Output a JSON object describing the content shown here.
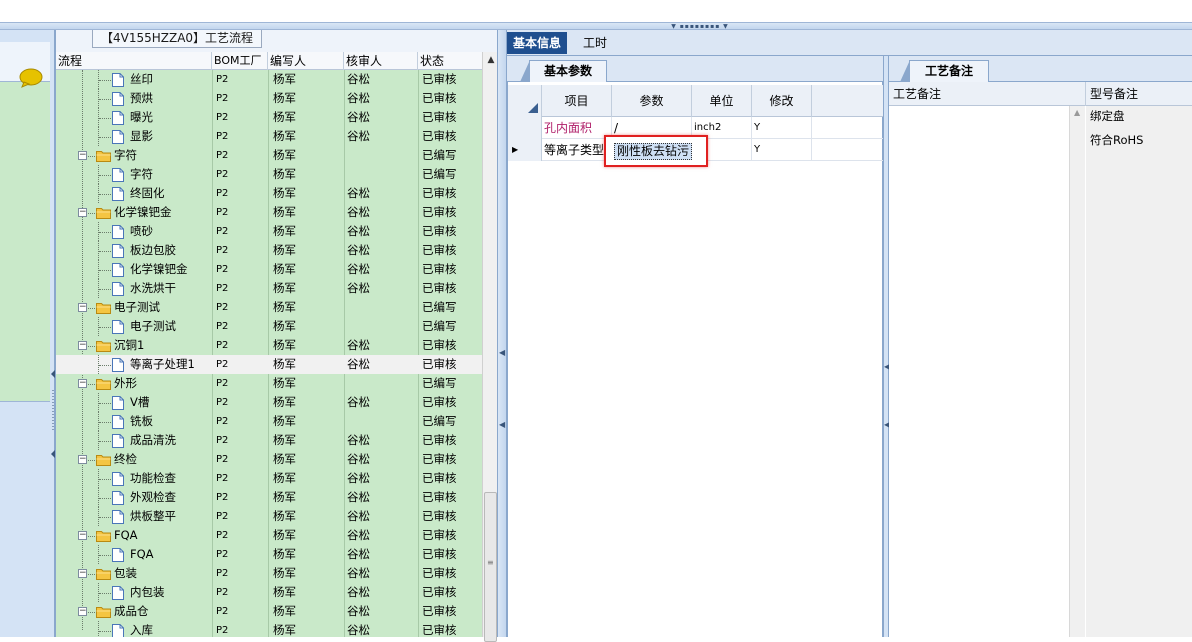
{
  "tree": {
    "title": "【4V155HZZA0】工艺流程",
    "columns": [
      "流程",
      "BOM工厂",
      "编写人",
      "核审人",
      "状态"
    ],
    "rows": [
      {
        "name": "丝印",
        "type": "doc",
        "bom": "P2",
        "author": "杨军",
        "reviewer": "谷松",
        "status": "已审核"
      },
      {
        "name": "预烘",
        "type": "doc",
        "bom": "P2",
        "author": "杨军",
        "reviewer": "谷松",
        "status": "已审核"
      },
      {
        "name": "曝光",
        "type": "doc",
        "bom": "P2",
        "author": "杨军",
        "reviewer": "谷松",
        "status": "已审核"
      },
      {
        "name": "显影",
        "type": "doc",
        "bom": "P2",
        "author": "杨军",
        "reviewer": "谷松",
        "status": "已审核"
      },
      {
        "name": "字符",
        "type": "folder",
        "bom": "P2",
        "author": "杨军",
        "reviewer": "",
        "status": "已编写"
      },
      {
        "name": "字符",
        "type": "doc",
        "bom": "P2",
        "author": "杨军",
        "reviewer": "",
        "status": "已编写"
      },
      {
        "name": "终固化",
        "type": "doc",
        "bom": "P2",
        "author": "杨军",
        "reviewer": "谷松",
        "status": "已审核"
      },
      {
        "name": "化学镍钯金",
        "type": "folder",
        "bom": "P2",
        "author": "杨军",
        "reviewer": "谷松",
        "status": "已审核"
      },
      {
        "name": "喷砂",
        "type": "doc",
        "bom": "P2",
        "author": "杨军",
        "reviewer": "谷松",
        "status": "已审核"
      },
      {
        "name": "板边包胶",
        "type": "doc",
        "bom": "P2",
        "author": "杨军",
        "reviewer": "谷松",
        "status": "已审核"
      },
      {
        "name": "化学镍钯金",
        "type": "doc",
        "bom": "P2",
        "author": "杨军",
        "reviewer": "谷松",
        "status": "已审核"
      },
      {
        "name": "水洗烘干",
        "type": "doc",
        "bom": "P2",
        "author": "杨军",
        "reviewer": "谷松",
        "status": "已审核"
      },
      {
        "name": "电子测试",
        "type": "folder",
        "bom": "P2",
        "author": "杨军",
        "reviewer": "",
        "status": "已编写"
      },
      {
        "name": "电子测试",
        "type": "doc",
        "bom": "P2",
        "author": "杨军",
        "reviewer": "",
        "status": "已编写"
      },
      {
        "name": "沉铜1",
        "type": "folder",
        "bom": "P2",
        "author": "杨军",
        "reviewer": "谷松",
        "status": "已审核"
      },
      {
        "name": "等离子处理1",
        "type": "doc",
        "bom": "P2",
        "author": "杨军",
        "reviewer": "谷松",
        "status": "已审核",
        "selected": true
      },
      {
        "name": "外形",
        "type": "folder",
        "bom": "P2",
        "author": "杨军",
        "reviewer": "",
        "status": "已编写"
      },
      {
        "name": "V槽",
        "type": "doc",
        "bom": "P2",
        "author": "杨军",
        "reviewer": "谷松",
        "status": "已审核"
      },
      {
        "name": "铣板",
        "type": "doc",
        "bom": "P2",
        "author": "杨军",
        "reviewer": "",
        "status": "已编写"
      },
      {
        "name": "成品清洗",
        "type": "doc",
        "bom": "P2",
        "author": "杨军",
        "reviewer": "谷松",
        "status": "已审核"
      },
      {
        "name": "终检",
        "type": "folder",
        "bom": "P2",
        "author": "杨军",
        "reviewer": "谷松",
        "status": "已审核"
      },
      {
        "name": "功能检查",
        "type": "doc",
        "bom": "P2",
        "author": "杨军",
        "reviewer": "谷松",
        "status": "已审核"
      },
      {
        "name": "外观检查",
        "type": "doc",
        "bom": "P2",
        "author": "杨军",
        "reviewer": "谷松",
        "status": "已审核"
      },
      {
        "name": "烘板整平",
        "type": "doc",
        "bom": "P2",
        "author": "杨军",
        "reviewer": "谷松",
        "status": "已审核"
      },
      {
        "name": "FQA",
        "type": "folder",
        "bom": "P2",
        "author": "杨军",
        "reviewer": "谷松",
        "status": "已审核"
      },
      {
        "name": "FQA",
        "type": "doc",
        "bom": "P2",
        "author": "杨军",
        "reviewer": "谷松",
        "status": "已审核"
      },
      {
        "name": "包装",
        "type": "folder",
        "bom": "P2",
        "author": "杨军",
        "reviewer": "谷松",
        "status": "已审核"
      },
      {
        "name": "内包装",
        "type": "doc",
        "bom": "P2",
        "author": "杨军",
        "reviewer": "谷松",
        "status": "已审核"
      },
      {
        "name": "成品仓",
        "type": "folder",
        "bom": "P2",
        "author": "杨军",
        "reviewer": "谷松",
        "status": "已审核"
      },
      {
        "name": "入库",
        "type": "doc",
        "bom": "P2",
        "author": "杨军",
        "reviewer": "谷松",
        "status": "已审核"
      }
    ]
  },
  "main_tabs": {
    "basic_info": "基本信息",
    "work_hours": "工时"
  },
  "params": {
    "tab": "基本参数",
    "columns": [
      "项目",
      "参数",
      "单位",
      "修改"
    ],
    "rows": [
      {
        "item": "孔内面积",
        "param": "/",
        "unit": "inch2",
        "modify": "Y"
      },
      {
        "item": "等离子类型",
        "param": "",
        "unit": "",
        "modify": "Y"
      }
    ],
    "editing_value": "刚性板去钻污"
  },
  "notes": {
    "tab": "工艺备注",
    "columns": [
      "工艺备注",
      "型号备注"
    ],
    "model_notes": [
      "绑定盘",
      "符合RoHS"
    ]
  },
  "colors": {
    "green_row": "#c9e9c9",
    "tab_active": "#1f4f8f",
    "highlight_red": "#e02020",
    "item_magenta": "#b0206a"
  }
}
